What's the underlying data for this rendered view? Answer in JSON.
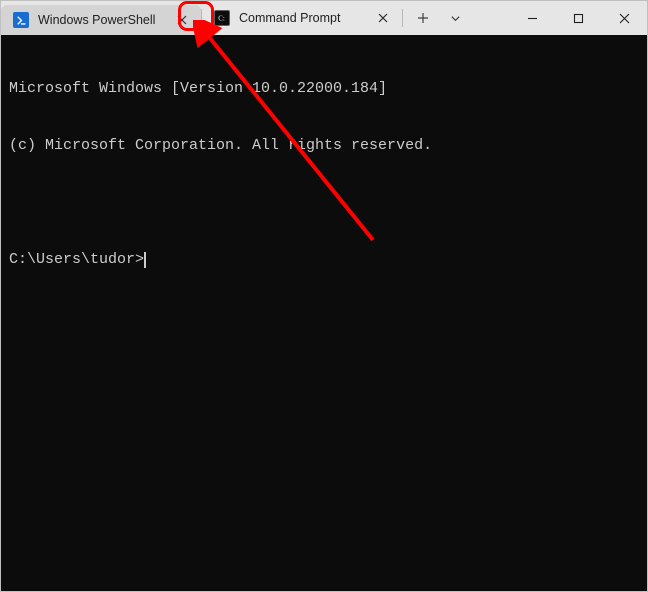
{
  "tabs": [
    {
      "label": "Windows PowerShell",
      "icon": "powershell"
    },
    {
      "label": "Command Prompt",
      "icon": "cmd"
    }
  ],
  "terminal": {
    "line1": "Microsoft Windows [Version 10.0.22000.184]",
    "line2": "(c) Microsoft Corporation. All rights reserved.",
    "prompt": "C:\\Users\\tudor>"
  }
}
